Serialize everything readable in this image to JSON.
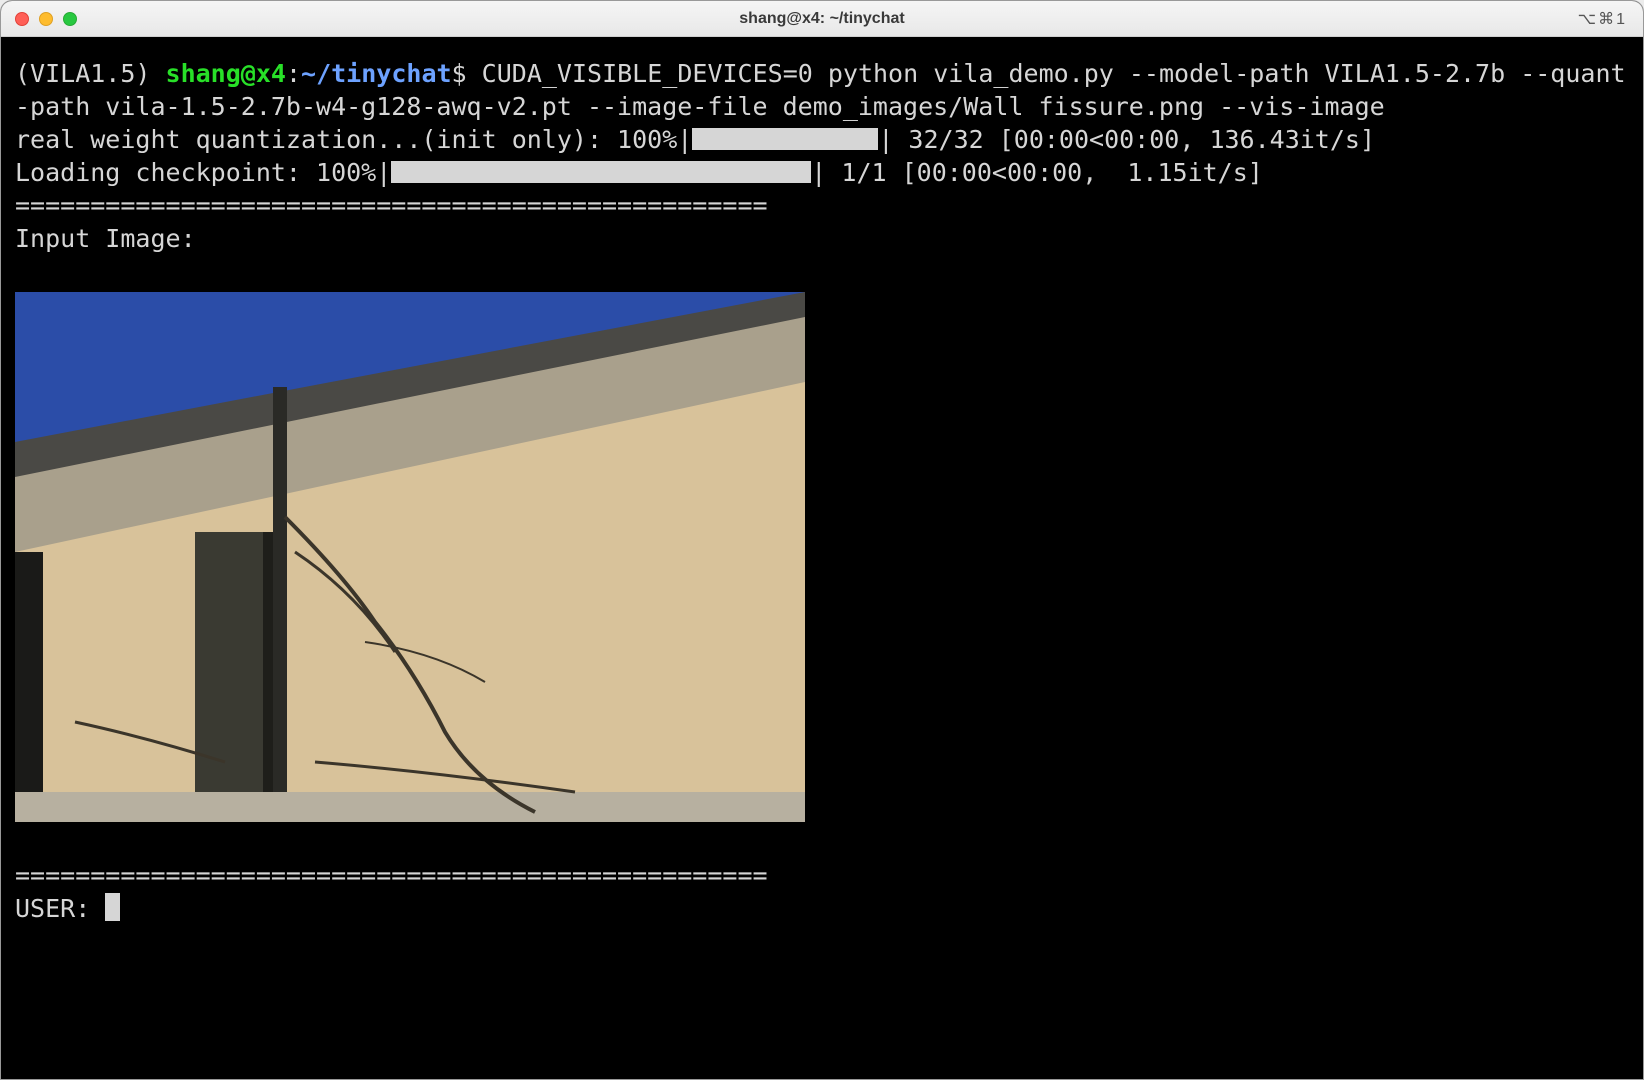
{
  "window": {
    "title": "shang@x4: ~/tinychat",
    "shortcut": "⌥⌘1"
  },
  "prompt": {
    "venv": "(VILA1.5)",
    "user": "shang",
    "at": "@",
    "host": "x4",
    "colon": ":",
    "path": "~/tinychat",
    "dollar": "$",
    "command": "CUDA_VISIBLE_DEVICES=0 python vila_demo.py --model-path VILA1.5-2.7b --quant-path vila-1.5-2.7b-w4-g128-awq-v2.pt --image-file demo_images/Wall fissure.png --vis-image"
  },
  "progress": {
    "line1_left": "real weight quantization...(init only): 100%|",
    "line1_right": "| 32/32 [00:00<00:00, 136.43it/s]",
    "line2_left": "Loading checkpoint: 100%|",
    "line2_right": "| 1/1 [00:00<00:00,  1.15it/s]"
  },
  "separator": "==================================================",
  "labels": {
    "input_image": "Input Image:",
    "user_prompt": "USER: "
  },
  "image": {
    "description": "building-wall-crack-photo"
  }
}
